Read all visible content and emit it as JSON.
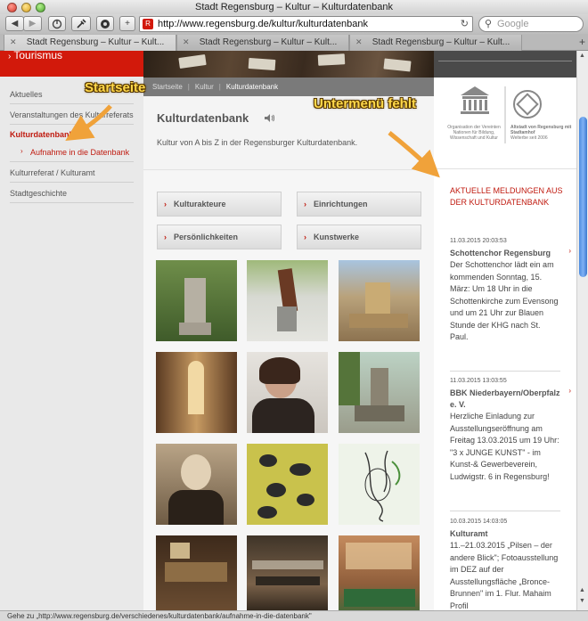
{
  "window": {
    "title": "Stadt Regensburg – Kultur – Kulturdatenbank"
  },
  "toolbar": {
    "url": "http://www.regensburg.de/kultur/kulturdatenbank",
    "favicon_glyph": "R",
    "search_placeholder": "Google",
    "back_label": "◀",
    "forward_label": "▶",
    "add_label": "+"
  },
  "tabs": [
    {
      "label": "Stadt Regensburg – Kultur – Kult..."
    },
    {
      "label": "Stadt Regensburg – Kultur – Kult..."
    },
    {
      "label": "Stadt Regensburg – Kultur – Kult..."
    }
  ],
  "sidebar": {
    "tourism_label": "Tourismus",
    "items": [
      {
        "label": "Aktuelles"
      },
      {
        "label": "Veranstaltungen des Kulturreferats"
      },
      {
        "label": "Kulturdatenbank"
      },
      {
        "label": "Aufnahme in die Datenbank"
      },
      {
        "label": "Kulturreferat / Kulturamt"
      },
      {
        "label": "Stadtgeschichte"
      }
    ]
  },
  "breadcrumb": {
    "items": [
      "Startseite",
      "Kultur",
      "Kulturdatenbank"
    ]
  },
  "main": {
    "title": "Kulturdatenbank",
    "intro": "Kultur von A bis Z in der Regensburger Kulturdatenbank.",
    "buttons": [
      "Kulturakteure",
      "Einrichtungen",
      "Persönlichkeiten",
      "Kunstwerke"
    ]
  },
  "unesco": {
    "left_caption": "Organisation der Vereinten Nationen für Bildung, Wissenschaft und Kultur",
    "right_caption_bold": "Altstadt von Regensburg mit Stadtamhof",
    "right_caption": "Welterbe seit 2006"
  },
  "news": {
    "heading": "AKTUELLE MELDUNGEN AUS DER KULTURDATENBANK",
    "items": [
      {
        "date": "11.03.2015 20:03:53",
        "title": "Schottenchor Regensburg",
        "text": "Der Schottenchor lädt ein am kommenden Sonntag, 15. März: Um 18 Uhr in die Schottenkirche zum Evensong und um 21 Uhr zur Blauen Stunde der KHG nach St. Paul."
      },
      {
        "date": "11.03.2015 13:03:55",
        "title": "BBK Niederbayern/Oberpfalz e. V.",
        "text": "Herzliche Einladung zur Ausstellungseröffnung am Freitag 13.03.2015 um 19 Uhr: \"3 x JUNGE KUNST\" - im Kunst-& Gewerbeverein, Ludwigstr. 6 in Regensburg!"
      },
      {
        "date": "10.03.2015 14:03:05",
        "title": "Kulturamt",
        "text": "11.–21.03.2015 „Pilsen – der andere Blick\"; Fotoausstellung im DEZ auf der Ausstellungsfläche „Bronce-Brunnen\" im 1. Flur. Mahaim Profil"
      }
    ]
  },
  "annotations": {
    "startseite": "Startseite",
    "untermenue": "Untermenü fehlt"
  },
  "status": {
    "text": "Gehe zu „http://www.regensburg.de/verschiedenes/kulturdatenbank/aufnahme-in-die-datenbank\""
  },
  "colors": {
    "brand_red": "#d2190b",
    "annotation": "#ffd84a",
    "arrow": "#f0a23a"
  }
}
